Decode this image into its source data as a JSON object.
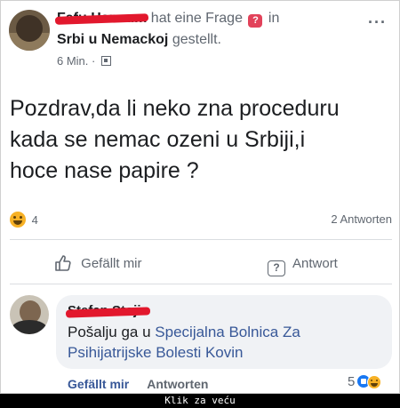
{
  "post": {
    "author": "Fafu Hanaum",
    "action_text": "hat eine Frage",
    "in_text": "in",
    "group": "Srbi u Nemackoj",
    "posted_text": "gestellt.",
    "time": "6 Min. ·",
    "more": "···",
    "body_line1": "Pozdrav,da li neko zna proceduru",
    "body_line2": "kada se nemac ozeni u Srbiji,i",
    "body_line3": "hoce nase papire ?",
    "reactions_count": "4",
    "answers_count": "2 Antworten",
    "like_label": "Gefällt mir",
    "answer_label": "Antwort"
  },
  "comment": {
    "author": "Stefan Stojic",
    "text_prefix": "Pošalju ga u ",
    "link_text": "Specijalna Bolnica Za Psihijatrijske Bolesti Kovin",
    "like_label": "Gefällt mir",
    "reply_label": "Antworten",
    "reactions_count": "5"
  },
  "caption": "Klik za veću"
}
